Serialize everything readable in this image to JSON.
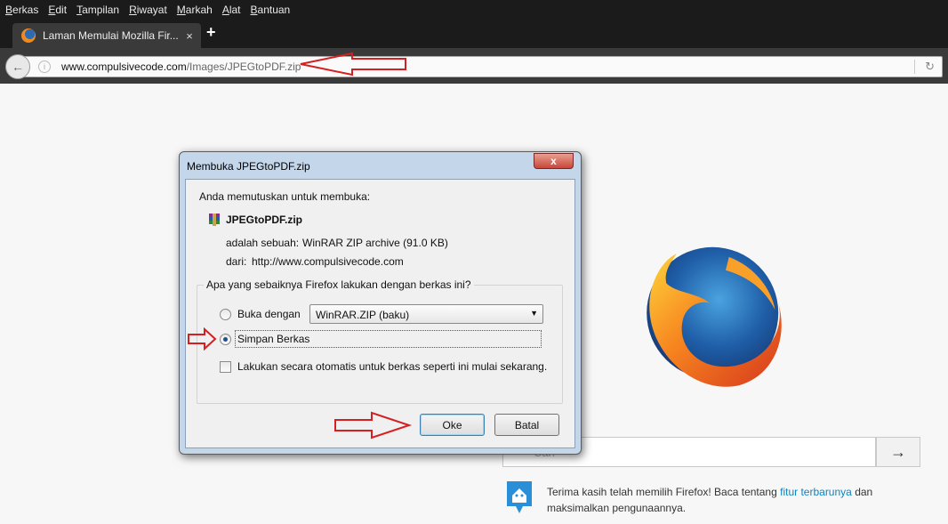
{
  "menu": {
    "items": [
      "Berkas",
      "Edit",
      "Tampilan",
      "Riwayat",
      "Markah",
      "Alat",
      "Bantuan"
    ],
    "accelerators": [
      "B",
      "E",
      "T",
      "R",
      "M",
      "A",
      "B"
    ]
  },
  "tab": {
    "title": "Laman Memulai Mozilla Fir...",
    "close": "×",
    "new_tab": "+"
  },
  "nav": {
    "back": "←",
    "url_domain": "www.compulsivecode.com",
    "url_path": "/Images/JPEGtoPDF.zip",
    "reload": "↻"
  },
  "dialog": {
    "title": "Membuka JPEGtoPDF.zip",
    "close": "x",
    "intro": "Anda memutuskan untuk membuka:",
    "filename": "JPEGtoPDF.zip",
    "type_label": "adalah sebuah:",
    "type_value": "WinRAR ZIP archive (91.0 KB)",
    "from_label": "dari:",
    "from_value": "http://www.compulsivecode.com",
    "question": "Apa yang sebaiknya Firefox lakukan dengan berkas ini?",
    "open_with_label": "Buka dengan",
    "open_with_value": "WinRAR.ZIP (baku)",
    "save_label": "Simpan Berkas",
    "auto_label": "Lakukan secara otomatis untuk berkas seperti ini mulai sekarang.",
    "ok_label": "Oke",
    "cancel_label": "Batal",
    "selected_option": "save",
    "auto_checked": false
  },
  "search": {
    "placeholder": "Cari",
    "go": "→"
  },
  "snippet": {
    "text_before": "Terima kasih telah memilih Firefox! Baca tentang",
    "link": "fitur terbarunya",
    "text_after": "dan maksimalkan pengunaannya."
  },
  "colors": {
    "annotation_arrow": "#d42020",
    "link": "#0a84c1",
    "chrome_dark": "#1b1b1b"
  }
}
